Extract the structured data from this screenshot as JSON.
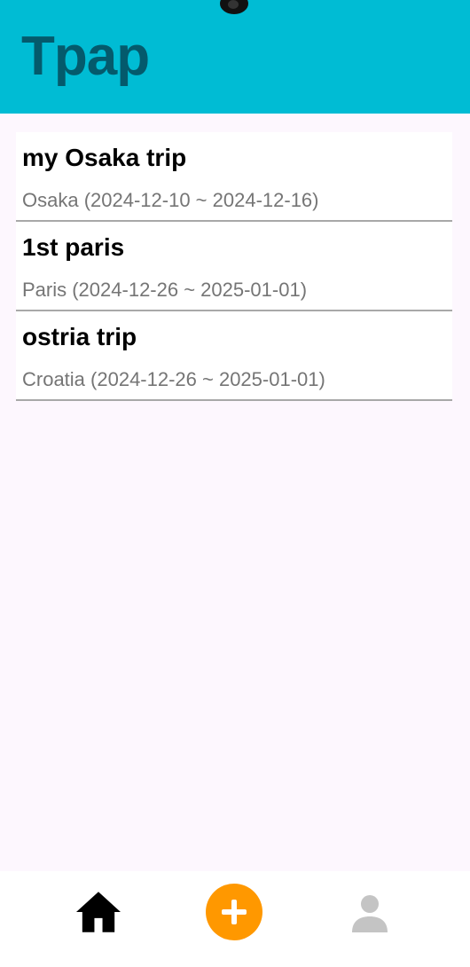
{
  "app": {
    "title": "Tpap"
  },
  "trips": [
    {
      "name": "my Osaka trip",
      "subtitle": "Osaka (2024-12-10 ~ 2024-12-16)"
    },
    {
      "name": "1st paris",
      "subtitle": "Paris (2024-12-26 ~ 2025-01-01)"
    },
    {
      "name": "ostria trip",
      "subtitle": "Croatia (2024-12-26 ~ 2025-01-01)"
    }
  ],
  "bottom_nav": {
    "items": [
      {
        "icon": "home-icon",
        "active": true
      },
      {
        "icon": "plus-icon",
        "active": false
      },
      {
        "icon": "person-icon",
        "active": false
      }
    ]
  },
  "colors": {
    "header": "#00bcd4",
    "title": "#045a6c",
    "accent": "#ff9800",
    "background": "#fdf7fe",
    "inactive_icon": "#c4c4c4"
  }
}
